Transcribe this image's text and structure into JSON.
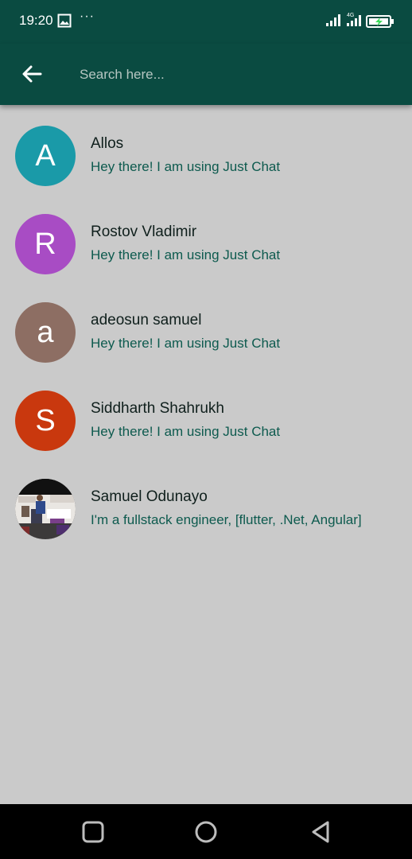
{
  "status_bar": {
    "time": "19:20",
    "more": "···",
    "network": "4G"
  },
  "appbar": {
    "search_placeholder": "Search here...",
    "color": "#0a4b41"
  },
  "contacts": [
    {
      "name": "Allos",
      "status": "Hey there! I am using Just Chat",
      "initial": "A",
      "color": "#1a9aa8"
    },
    {
      "name": "Rostov Vladimir",
      "status": "Hey there! I am using Just Chat",
      "initial": "R",
      "color": "#a84cc4"
    },
    {
      "name": "adeosun samuel",
      "status": "Hey there! I am using Just Chat",
      "initial": "a",
      "color": "#8d6e63"
    },
    {
      "name": "Siddharth Shahrukh",
      "status": "Hey there! I am using Just Chat",
      "initial": "S",
      "color": "#c9380e"
    },
    {
      "name": "Samuel Odunayo",
      "status": "I'm a fullstack engineer, [flutter, .Net, Angular]",
      "initial": "",
      "color": "#333333"
    }
  ]
}
